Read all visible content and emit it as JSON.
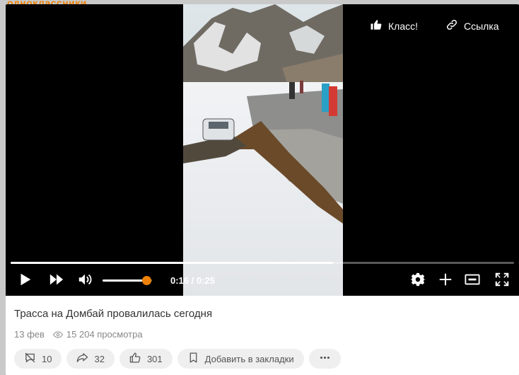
{
  "site": {
    "logo_text": "одноклассники",
    "accent": "#ee8208"
  },
  "player": {
    "top_actions": [
      {
        "label": "Класс!",
        "icon": "thumbs-up-icon"
      },
      {
        "label": "Ссылка",
        "icon": "link-icon"
      }
    ],
    "progress_fraction": 0.64,
    "volume_fraction": 0.89,
    "time_text": "0:16 / 0:25",
    "controls": {
      "left": [
        "play-icon",
        "next-icon",
        "volume-icon"
      ],
      "right": [
        "settings-icon",
        "plus-icon",
        "subtitles-icon",
        "fullscreen-icon"
      ]
    }
  },
  "video": {
    "title": "Трасса на Домбай провалилась сегодня",
    "date": "13 фев",
    "views": "15 204 просмотра"
  },
  "actions": {
    "comments": "10",
    "shares": "32",
    "likes": "301",
    "bookmark": "Добавить в закладки",
    "more_icon": "more-icon"
  }
}
